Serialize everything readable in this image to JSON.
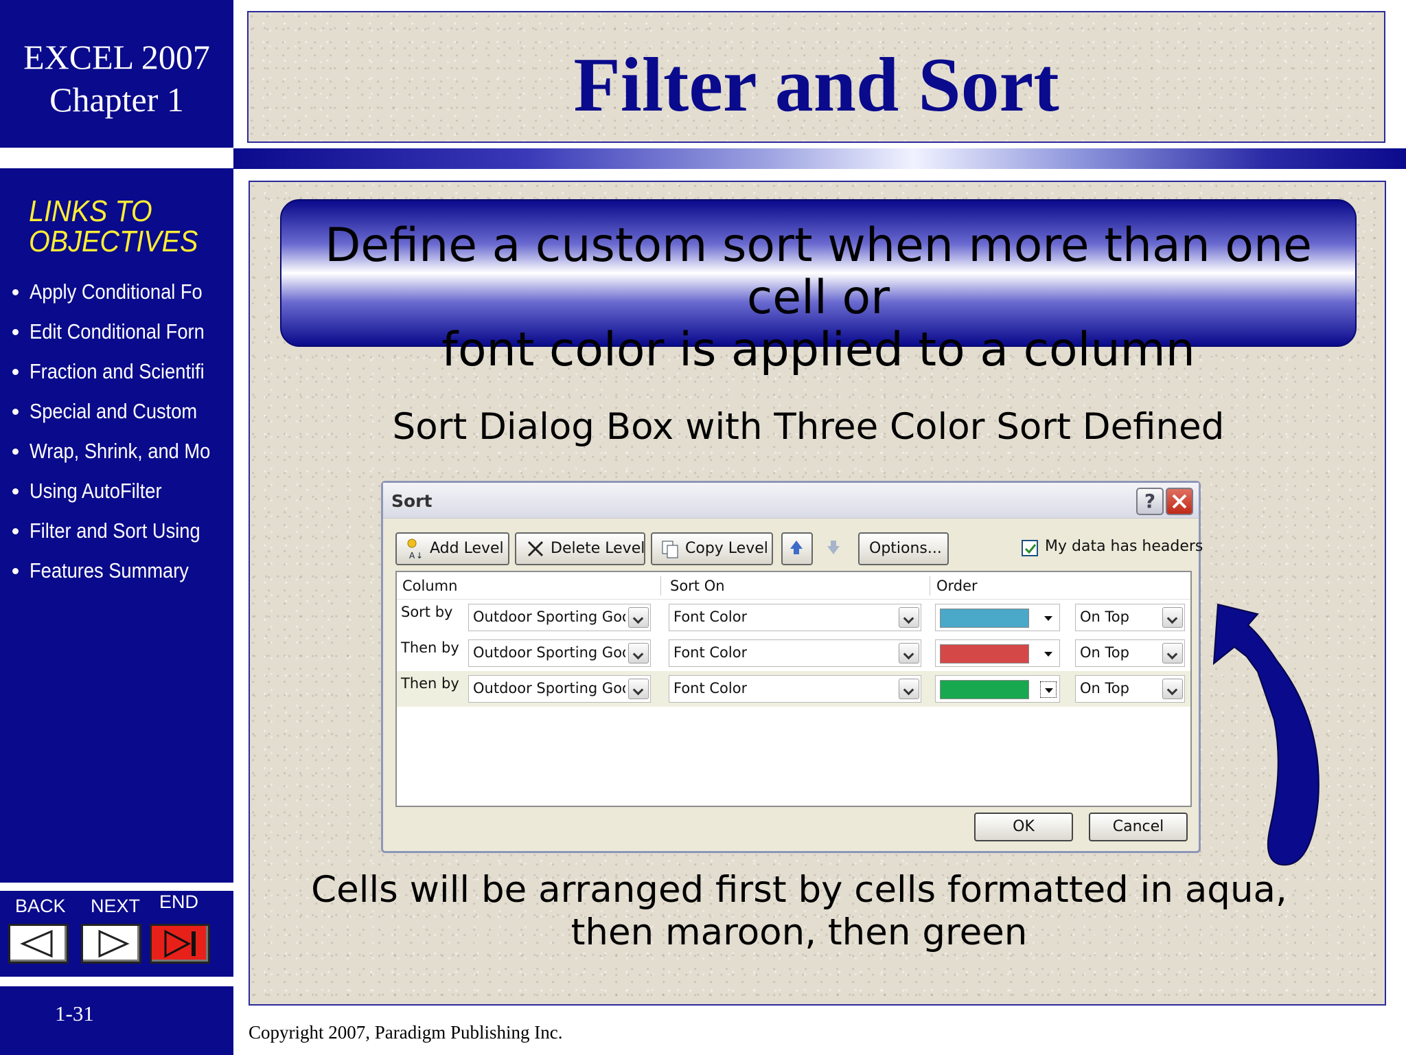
{
  "sidebar": {
    "brand_line1": "EXCEL 2007",
    "brand_line2": "Chapter 1",
    "links_title_line1": "LINKS TO",
    "links_title_line2": "OBJECTIVES",
    "links": [
      "Apply Conditional Fo",
      "Edit Conditional Forn",
      "Fraction and Scientifi",
      "Special and Custom",
      "Wrap, Shrink, and Mo",
      "Using AutoFilter",
      "Filter and Sort Using",
      "Features Summary"
    ],
    "nav": {
      "back": "BACK",
      "next": "NEXT",
      "end": "END"
    },
    "page_number": "1-31"
  },
  "slide": {
    "title": "Filter and Sort",
    "banner_line1": "Define a custom sort when more than one cell or",
    "banner_line2": "font color is applied to a column",
    "subtitle": "Sort Dialog Box with Three Color Sort Defined",
    "caption_line1": "Cells will be arranged first by cells formatted in aqua,",
    "caption_line2": "then maroon, then green",
    "copyright": "Copyright 2007, Paradigm Publishing Inc."
  },
  "dialog": {
    "title": "Sort",
    "help": "?",
    "toolbar": {
      "add_level": "Add Level",
      "delete_level": "Delete Level",
      "copy_level": "Copy Level",
      "options": "Options...",
      "headers_checkbox": "My data has headers"
    },
    "columns": {
      "column": "Column",
      "sort_on": "Sort On",
      "order": "Order"
    },
    "rows": [
      {
        "label": "Sort by",
        "column": "Outdoor Sporting Goods",
        "sort_on": "Font Color",
        "color": "#4aa8c8",
        "position": "On Top"
      },
      {
        "label": "Then by",
        "column": "Outdoor Sporting Goods",
        "sort_on": "Font Color",
        "color": "#d44848",
        "position": "On Top"
      },
      {
        "label": "Then by",
        "column": "Outdoor Sporting Goods",
        "sort_on": "Font Color",
        "color": "#18a850",
        "position": "On Top"
      }
    ],
    "ok": "OK",
    "cancel": "Cancel"
  },
  "colors": {
    "navy": "#0a0a8c",
    "links_title": "#ffee33",
    "end_button": "#e8201a",
    "beige": "#e3ddd0"
  }
}
